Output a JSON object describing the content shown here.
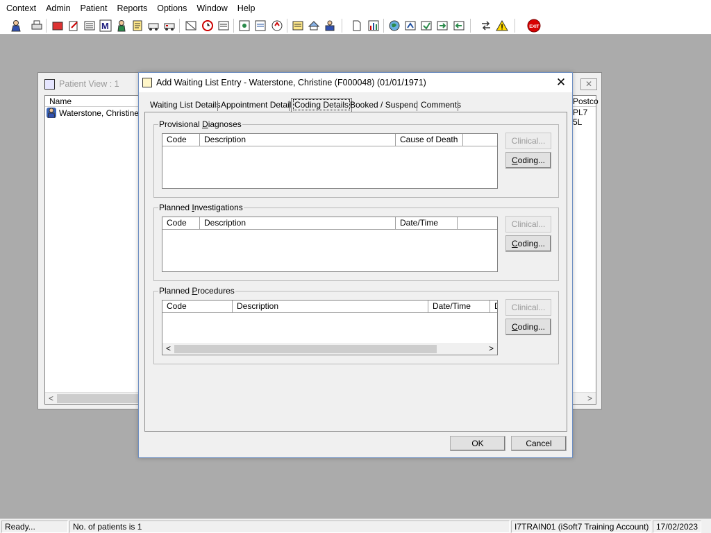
{
  "menu": [
    "Context",
    "Admin",
    "Patient",
    "Reports",
    "Options",
    "Window",
    "Help"
  ],
  "toolbar": {
    "icons": [
      "patient-icon",
      "print-icon",
      "folder-icon",
      "edit-note-icon",
      "list-icon",
      "m-icon",
      "person-icon",
      "document-edit-icon",
      "vehicle-icon",
      "vehicle2-icon",
      "inbox-icon",
      "clock-icon",
      "window-icon",
      "image-icon",
      "chart-icon",
      "refresh-icon",
      "note-icon",
      "transfer-icon",
      "printer-person-icon",
      "page-icon",
      "bar-chart-icon",
      "globe-icon",
      "flag-icon",
      "forward-icon",
      "reload-icon",
      "arrow-green-icon",
      "swap-icon",
      "warning-icon",
      "exit-icon"
    ]
  },
  "patient_view": {
    "title": "Patient View : 1",
    "col_name": "Name",
    "col_postcode": "Postco",
    "row_name": "Waterstone, Christine...",
    "row_postcode": "PL7 5L"
  },
  "dialog": {
    "title": "Add Waiting List Entry - Waterstone, Christine (F000048) (01/01/1971)",
    "tabs": [
      "Waiting List Details",
      "Appointment Details",
      "Coding Details",
      "Booked / Suspend",
      "Comments"
    ],
    "groups": {
      "diagnoses": {
        "legend_pre": "Provisional ",
        "legend_u": "D",
        "legend_post": "iagnoses",
        "columns": [
          "Code",
          "Description",
          "Cause of Death",
          ""
        ]
      },
      "investigations": {
        "legend_pre": "Planned ",
        "legend_u": "I",
        "legend_post": "nvestigations",
        "columns": [
          "Code",
          "Description",
          "Date/Time",
          ""
        ]
      },
      "procedures": {
        "legend_pre": "Planned ",
        "legend_u": "P",
        "legend_post": "rocedures",
        "columns": [
          "Code",
          "Description",
          "Date/Time",
          "D"
        ]
      }
    },
    "clinical_label": "Clinical...",
    "coding_label_u": "C",
    "coding_label_rest": "oding...",
    "ok_label": "OK",
    "cancel_label": "Cancel"
  },
  "status": {
    "ready": "Ready...",
    "patients": "No. of patients is 1",
    "account": "I7TRAIN01 (iSoft7 Training Account)",
    "date": "17/02/2023"
  }
}
